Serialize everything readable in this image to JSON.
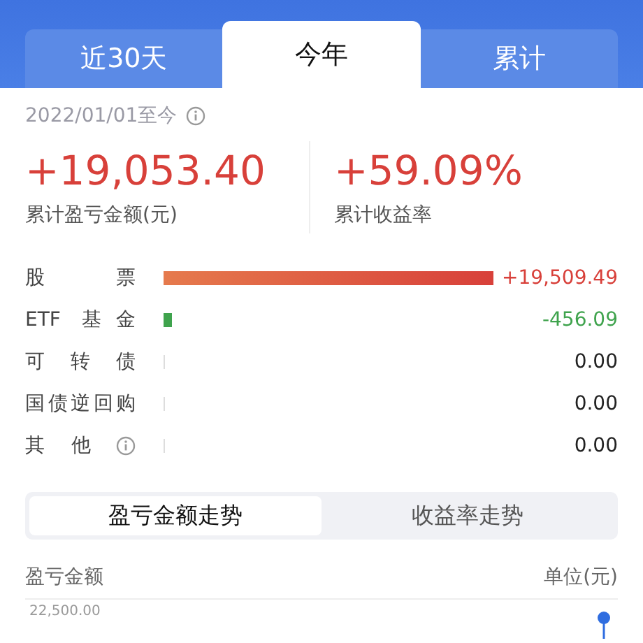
{
  "tabs": [
    {
      "label": "近30天",
      "selected": false
    },
    {
      "label": "今年",
      "selected": true
    },
    {
      "label": "累计",
      "selected": false
    }
  ],
  "period": {
    "text": "2022/01/01至今",
    "info": true
  },
  "summary": [
    {
      "value": "+19,053.40",
      "label": "累计盈亏金额(元)",
      "color": "#d8403a"
    },
    {
      "value": "+59.09%",
      "label": "累计收益率",
      "color": "#d8403a"
    }
  ],
  "breakdown": [
    {
      "label": "股票",
      "color": "#d8403a",
      "value": "+19,509.49"
    },
    {
      "label": "ETF 基金",
      "color": "#3fa34d",
      "value": "-456.09"
    },
    {
      "label": "可转债",
      "color": "#222222",
      "value": "0.00"
    },
    {
      "label": "国债逆回购",
      "color": "#222222",
      "value": "0.00"
    },
    {
      "label": "其他",
      "info": true,
      "color": "#222222",
      "value": "0.00"
    }
  ],
  "chart_switch": [
    {
      "label": "盈亏金额走势",
      "selected": true
    },
    {
      "label": "收益率走势",
      "selected": false
    }
  ],
  "chart": {
    "title": "盈亏金额",
    "unit": "单位(元)",
    "top_tick": "22,500.00"
  }
}
